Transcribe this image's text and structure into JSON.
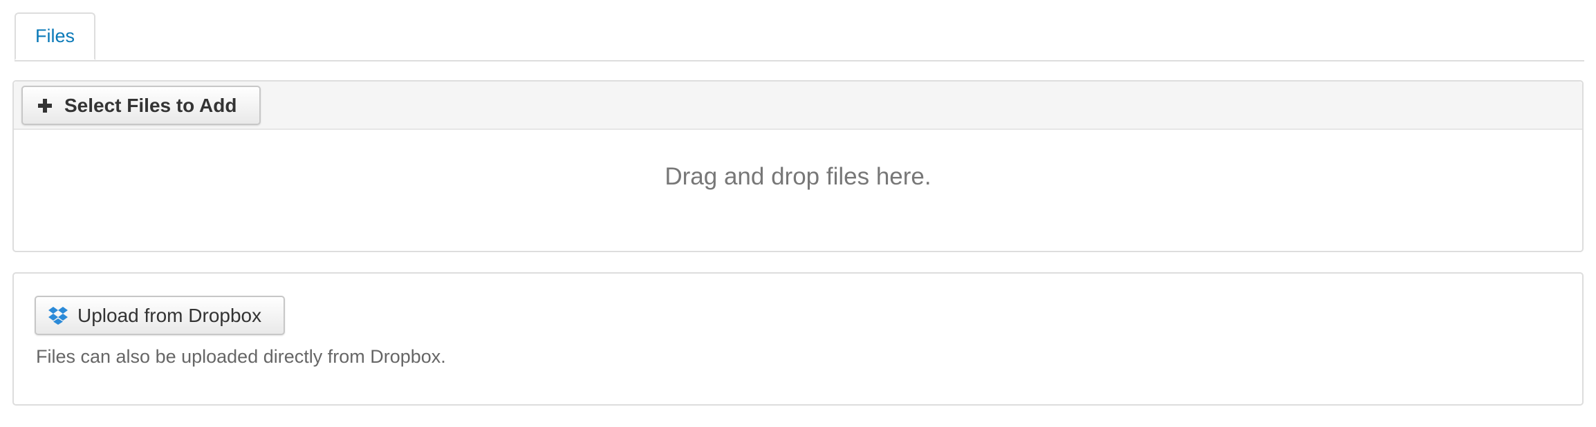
{
  "tabs": [
    {
      "label": "Files",
      "active": true
    }
  ],
  "upload": {
    "select_button_label": "Select Files to Add",
    "select_button_icon": "plus-icon",
    "drop_hint": "Drag and drop files here."
  },
  "dropbox": {
    "button_label": "Upload from Dropbox",
    "button_icon": "dropbox-icon",
    "help_text": "Files can also be uploaded directly from Dropbox."
  },
  "colors": {
    "tab_text": "#0a79b8",
    "dropbox_blue": "#2b8ad8",
    "border": "#dddddd"
  }
}
